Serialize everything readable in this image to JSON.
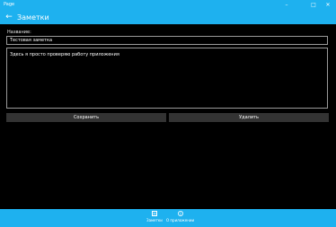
{
  "window": {
    "title": "Page",
    "minimize_icon": "minimize-icon",
    "maximize_icon": "maximize-icon",
    "close_icon": "close-icon"
  },
  "header": {
    "back_icon": "back-arrow-icon",
    "title": "Заметки"
  },
  "form": {
    "name_label": "Название:",
    "name_value": "Тестовая заметка",
    "body_value": "Здесь я просто проверяю работу приложения"
  },
  "actions": {
    "save_label": "Сохранить",
    "delete_label": "Удалить"
  },
  "bottom_nav": {
    "items": [
      {
        "label": "Заметки",
        "icon": "notes-icon"
      },
      {
        "label": "О приложении",
        "icon": "info-icon"
      }
    ]
  },
  "colors": {
    "accent": "#1eb1ef",
    "background": "#000000",
    "button_bg": "#333333",
    "border": "#9a9a9a"
  }
}
